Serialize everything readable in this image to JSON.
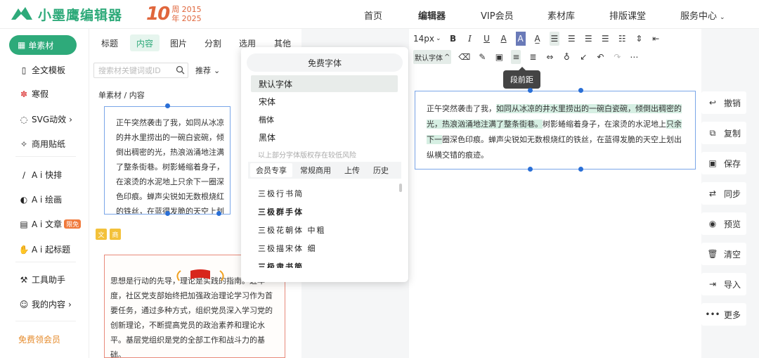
{
  "brand": {
    "name": "小墨鹰编辑器",
    "anniv_big": "10",
    "anniv_small": "周 2015\n年 2025"
  },
  "nav": {
    "items": [
      "首页",
      "编辑器",
      "VIP会员",
      "素材库",
      "排版课堂",
      "服务中心"
    ],
    "active": "编辑器"
  },
  "sidebar": {
    "active": "单素材",
    "items": [
      "全文模板",
      "寒假",
      "SVG动效",
      "商用贴纸",
      "A i 快排",
      "A i 绘画",
      "A i 文章",
      "A i 起标题",
      "工具助手",
      "我的内容"
    ],
    "limit_badge": "限免",
    "member": "免费领会员"
  },
  "panel": {
    "tabs": [
      "标题",
      "内容",
      "图片",
      "分割",
      "选用",
      "其他"
    ],
    "active_tab": "内容",
    "search_placeholder": "搜索材关键词或ID",
    "sort": "推荐",
    "crumb": "单素材 / 内容",
    "card1": "正午突然袭击了我，如同从冰凉的井水里捞出的一碗白瓷碗，倾倒出稠密的光，热浪汹涌地注满了整条街巷。树影蜷缩着身子，在滚烫的水泥地上只余下一圈深色印痕。蝉声尖锐如无数根烧红的铁丝，在蓝得发脆的天空上划出纵横交错的痕迹。",
    "card2": "思想是行动的先导，理论是实践的指南。近年度，社区党支部始终把加强政治理论学习作为首要任务，通过多种方式，组织党员深入学习党的创新理论，不断提高党员的政治素养和理论水平。基层党组织是党的全部工作和战斗力的基础。",
    "tag1": "文",
    "tag2": "商"
  },
  "toolbar": {
    "font_size": "14px",
    "font_family": "默认字体",
    "tooltip": "段前距"
  },
  "editor": {
    "text_before": "正午突然袭击了我，",
    "text_hl": "如同从冰凉的井水里捞出的一碗白瓷碗，倾倒出稠密的光，热浪汹涌地注满了整条街巷。",
    "text_mid": "树影蜷缩着身子，在滚烫的水泥地上",
    "text_hl2": "只余下一",
    "text_after": "圈深色印痕。蝉声尖锐如无数根烧红的铁丝，在蓝得发脆的天空上划出纵横交错的痕迹。"
  },
  "right_actions": [
    "撤销",
    "复制",
    "保存",
    "同步",
    "预览",
    "清空",
    "导入",
    "更多"
  ],
  "font_dropdown": {
    "header": "免费字体",
    "items": [
      "默认字体",
      "宋体",
      "楷体",
      "黑体"
    ],
    "active": "默认字体",
    "warning": "以上部分字体版权存在较低风险",
    "tabs": [
      "会员专享",
      "常规商用",
      "上传",
      "历史"
    ],
    "active_tab": "会员专享",
    "styles": [
      "三极行书简",
      "三极群手体",
      "三极花朝体 中粗",
      "三极描宋体 细",
      "三极隶书简"
    ]
  },
  "colors": {
    "brand": "#2eaa7a",
    "accent": "#e0663c",
    "selection": "#7aa6e8"
  }
}
